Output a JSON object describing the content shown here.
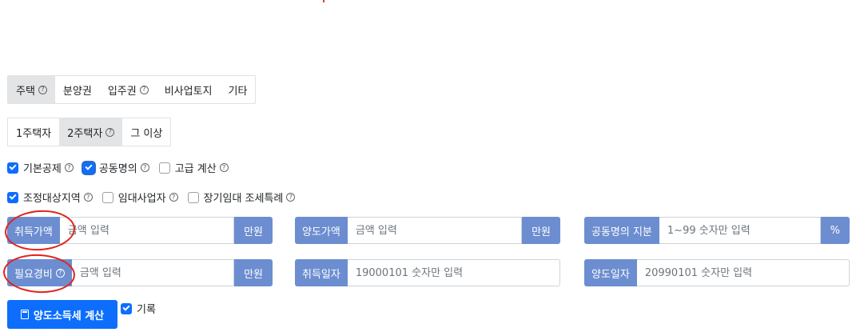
{
  "property_tabs": [
    {
      "label": "주택",
      "help": true,
      "active": true
    },
    {
      "label": "분양권",
      "help": false,
      "active": false
    },
    {
      "label": "입주권",
      "help": true,
      "active": false
    },
    {
      "label": "비사업토지",
      "help": false,
      "active": false
    },
    {
      "label": "기타",
      "help": false,
      "active": false
    }
  ],
  "owner_tabs": [
    {
      "label": "1주택자",
      "help": false,
      "active": false
    },
    {
      "label": "2주택자",
      "help": true,
      "active": true
    },
    {
      "label": "그 이상",
      "help": false,
      "active": false
    }
  ],
  "help_glyph": "?",
  "options_row1": [
    {
      "label": "기본공제",
      "checked": true
    },
    {
      "label": "공동명의",
      "checked": true
    },
    {
      "label": "고급 계산",
      "checked": false
    }
  ],
  "options_row2": [
    {
      "label": "조정대상지역",
      "checked": true
    },
    {
      "label": "임대사업자",
      "checked": false
    },
    {
      "label": "장기임대 조세특례",
      "checked": false
    }
  ],
  "fields": {
    "acq_price": {
      "label": "취득가액",
      "placeholder": "금액 입력",
      "unit": "만원"
    },
    "sale_price": {
      "label": "양도가액",
      "placeholder": "금액 입력",
      "unit": "만원"
    },
    "share": {
      "label": "공동명의 지분",
      "placeholder": "1~99 숫자만 입력",
      "unit": "%"
    },
    "expense": {
      "label": "필요경비",
      "placeholder": "금액 입력",
      "unit": "만원"
    },
    "acq_date": {
      "label": "취득일자",
      "placeholder": "19000101 숫자만 입력"
    },
    "sale_date": {
      "label": "양도일자",
      "placeholder": "20990101 숫자만 입력"
    }
  },
  "calc_button": {
    "label": "양도소득세 계산",
    "icon": "calculator-icon"
  },
  "record": {
    "label": "기록",
    "checked": true
  },
  "colors": {
    "primary": "#0d6efd",
    "label_bg": "#6c8ed0",
    "annotation": "#e0231b"
  }
}
